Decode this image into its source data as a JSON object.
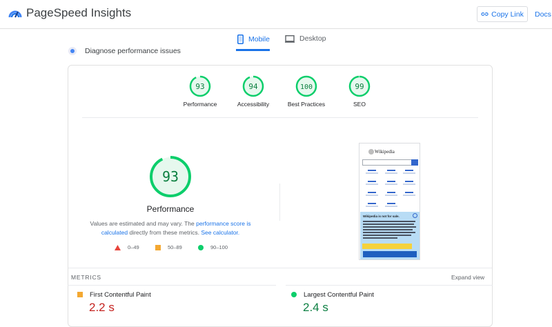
{
  "app": {
    "title": "PageSpeed Insights"
  },
  "header": {
    "copy_link": "Copy Link",
    "docs": "Docs"
  },
  "tabs": [
    {
      "label": "Mobile",
      "active": true
    },
    {
      "label": "Desktop",
      "active": false
    }
  ],
  "section_title": "Diagnose performance issues",
  "scores": [
    {
      "value": "93",
      "label": "Performance"
    },
    {
      "value": "94",
      "label": "Accessibility"
    },
    {
      "value": "100",
      "label": "Best Practices"
    },
    {
      "value": "99",
      "label": "SEO"
    }
  ],
  "main_score": {
    "value": "93",
    "label": "Performance"
  },
  "note": {
    "prefix": "Values are estimated and may vary. The ",
    "link1": "performance score is calculated",
    "middle": " directly from these metrics. ",
    "link2": "See calculator."
  },
  "legend": [
    {
      "range": "0–49"
    },
    {
      "range": "50–89"
    },
    {
      "range": "90–100"
    }
  ],
  "preview": {
    "site_name": "Wikipedia",
    "banner_title": "Wikipedia is not for sale."
  },
  "metrics": {
    "header": "METRICS",
    "expand": "Expand view",
    "items": [
      {
        "name": "First Contentful Paint",
        "value": "2.2 s"
      },
      {
        "name": "Largest Contentful Paint",
        "value": "2.4 s"
      }
    ]
  },
  "colors": {
    "pass": "#0cce6b",
    "average": "#f4a832",
    "fail": "#e8453c",
    "accent": "#1a73e8"
  }
}
